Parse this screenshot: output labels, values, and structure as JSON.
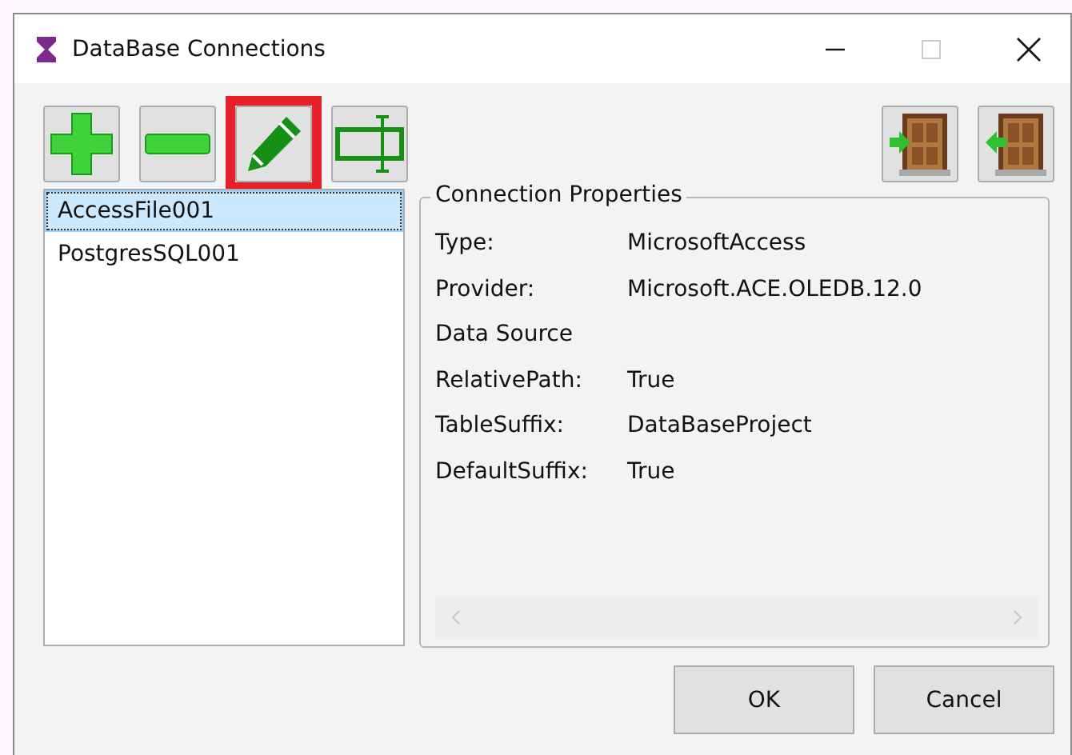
{
  "window": {
    "title": "DataBase Connections",
    "maximize_disabled": true
  },
  "toolbar": [
    {
      "kind": "add",
      "highlighted": false
    },
    {
      "kind": "remove",
      "highlighted": false
    },
    {
      "kind": "edit",
      "highlighted": true
    },
    {
      "kind": "resize",
      "highlighted": false
    }
  ],
  "toolbar_right": [
    {
      "kind": "door-in"
    },
    {
      "kind": "door-out"
    }
  ],
  "connections": [
    {
      "label": "AccessFile001",
      "selected": true
    },
    {
      "label": "PostgresSQL001",
      "selected": false
    }
  ],
  "properties": {
    "title": "Connection Properties",
    "rows": [
      {
        "name": "Type:",
        "value": "MicrosoftAccess"
      },
      {
        "name": "Provider:",
        "value": "Microsoft.ACE.OLEDB.12.0"
      },
      {
        "name": "Data Source"
      },
      {
        "name": "RelativePath:",
        "value": "True"
      },
      {
        "name": "TableSuffix:",
        "value": "DataBaseProject"
      },
      {
        "name": "DefaultSuffix:",
        "value": "True"
      }
    ]
  },
  "buttons": [
    "OK",
    "Cancel"
  ]
}
